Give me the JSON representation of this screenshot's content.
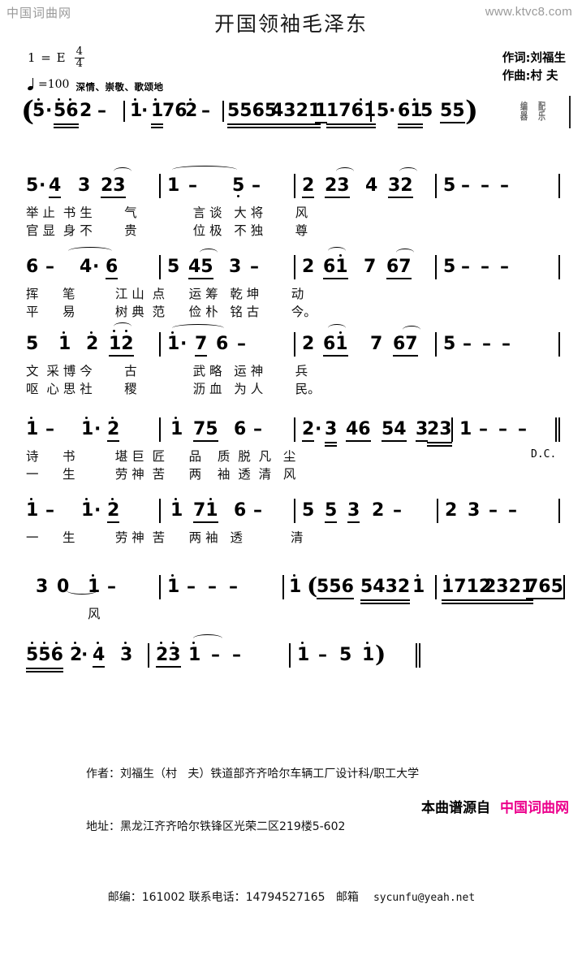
{
  "watermark": {
    "top_left": "中国词曲网",
    "top_right": "www.ktvc8.com"
  },
  "title": "开国领袖毛泽东",
  "key_signature": {
    "label": "1 = E",
    "time_numerator": "4",
    "time_denominator": "4",
    "tempo": "=100",
    "mood": "深情、崇敬、歌颂地"
  },
  "credits": {
    "lyricist": "作词:刘福生",
    "composer": "作曲:村  夫"
  },
  "seal": {
    "chars": [
      "编",
      "配",
      "器",
      "乐"
    ]
  },
  "markings": {
    "dc": "D.C."
  },
  "chart_data": {
    "type": "table",
    "title": "开国领袖毛泽东 — 简谱 (numbered musical notation)",
    "key": "1 = E",
    "time": "4/4",
    "tempo_bpm": 100,
    "expression": "深情、崇敬、歌颂地",
    "systems": [
      {
        "id": "intro",
        "kind": "instrumental-intro",
        "bracketed": true,
        "measures": [
          "5· 56 2 -",
          "1 · 1 7 6 2 -",
          "5565 4321 1 1761",
          "5· 61 5  55"
        ]
      },
      {
        "id": "system-1",
        "measures": [
          "5·4 3 23",
          "1 - 5 -",
          "2 23 4 32",
          "5 - - -"
        ],
        "lyrics_1": [
          "举",
          "止",
          "书",
          "生",
          "气"
        ],
        "lyrics_2": [
          "官",
          "显",
          "身",
          "不",
          "贵"
        ],
        "lyrics_line_1": "举 止  书 生        气              言 谈   大 将        风",
        "lyrics_line_2": "官 显  身 不        贵              位 极   不 独        尊"
      },
      {
        "id": "system-2",
        "measures": [
          "6 - 4· 6",
          "5 45 3 -",
          "2 61 7 67",
          "5 - - -"
        ],
        "lyrics_line_1": "挥      笔          江 山  点      运 筹   乾 坤        动",
        "lyrics_line_2": "平      易          树 典  范      俭 朴   铭 古        今。"
      },
      {
        "id": "system-3",
        "measures": [
          "5 1 2 12",
          "1· 7 6 -",
          "2 61 7 67",
          "5 - - -"
        ],
        "lyrics_line_1": "文  采 博 今        古              武 略   运 神        兵",
        "lyrics_line_2": "呕  心 思 社        稷              沥 血   为 人        民。"
      },
      {
        "id": "system-4",
        "measures": [
          "1 - 1· 2",
          "1 75 6 -",
          "2·3 46 54 323",
          "1 - - -"
        ],
        "lyrics_line_1": "诗      书          堪 巨  匠      品    质  脱  凡   尘",
        "lyrics_line_2": "一      生          劳 神  苦      两    袖  透  清   风"
      },
      {
        "id": "system-5",
        "measures": [
          "1 - 1· 2",
          "1 71 6 -",
          "5 5 3 2 -",
          "2 3 - -"
        ],
        "lyrics_line_1": "一      生          劳 神  苦      两 袖   透            清"
      },
      {
        "id": "system-6",
        "kind": "with-interlude",
        "measures": [
          "3 0 1 -",
          "1 - - -",
          "1 (556 5432 1",
          "17122321765"
        ],
        "lyrics_line_1": "风"
      },
      {
        "id": "system-7",
        "kind": "instrumental-ending",
        "measures": [
          "556 2·4 3",
          "23 1 - -",
          "1 - 5 1 )"
        ]
      }
    ]
  },
  "footer": {
    "line1": "作者：刘福生（村   夫）铁道部齐齐哈尔车辆工厂设计科/职工大学",
    "line2": "地址：黑龙江齐齐哈尔铁锋区光荣二区219楼5-602",
    "line3_prefix": "邮编：161002 联系电话：14794527165   邮箱",
    "line3_mail": "sycunfu@yeah.net"
  },
  "brand": {
    "prefix": "本曲谱源自",
    "site": "中国词曲网",
    "color": "#ec008c"
  }
}
